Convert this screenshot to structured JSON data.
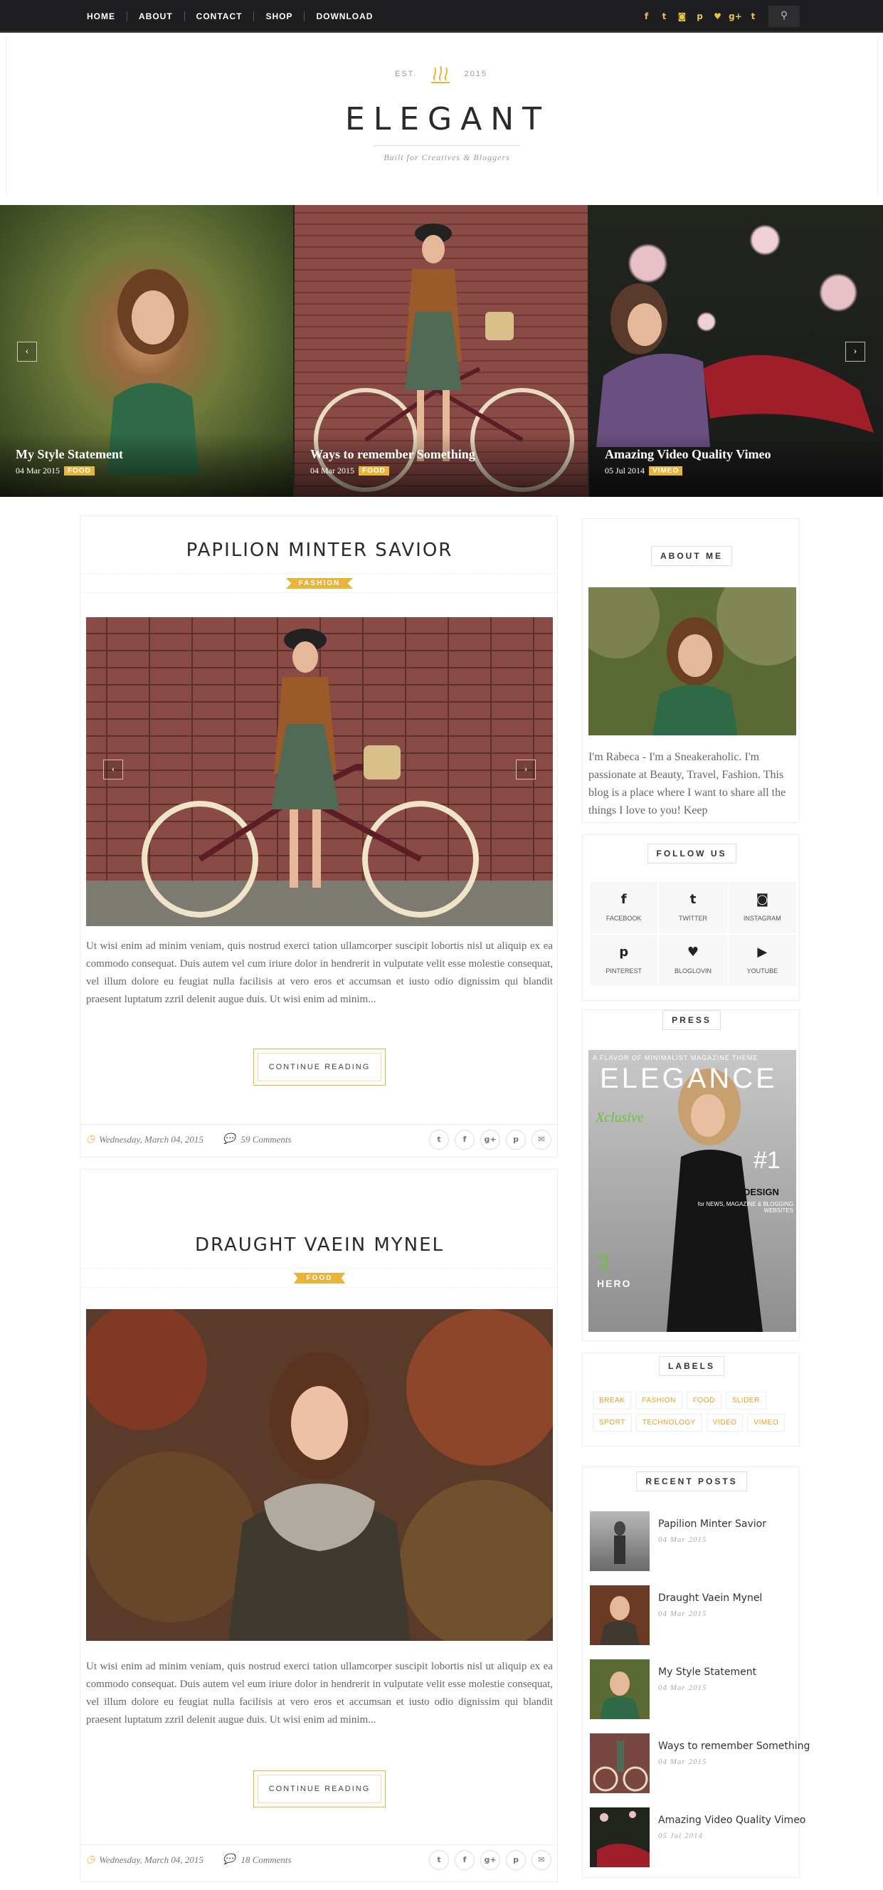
{
  "topbar": {
    "nav": [
      "HOME",
      "ABOUT",
      "CONTACT",
      "SHOP",
      "DOWNLOAD"
    ],
    "social_icons": [
      "facebook-icon",
      "twitter-icon",
      "instagram-icon",
      "pinterest-icon",
      "heart-icon",
      "google-plus-icon",
      "tumblr-icon"
    ],
    "social_glyphs": [
      "f",
      "t",
      "◙",
      "p",
      "♥",
      "g+",
      "t"
    ],
    "search_glyph": "⚲"
  },
  "header": {
    "est": "EST.",
    "year": "2015",
    "logo": "ELEGANT",
    "tagline": "Built for Creatives & Bloggers"
  },
  "slider": {
    "slides": [
      {
        "title": "My Style Statement",
        "date": "04 Mar 2015",
        "tag": "FOOD"
      },
      {
        "title": "Ways to remember Something",
        "date": "04 Mar 2015",
        "tag": "FOOD"
      },
      {
        "title": "Amazing Video Quality Vimeo",
        "date": "05 Jul 2014",
        "tag": "VIMEO"
      }
    ],
    "prev": "‹",
    "next": "›"
  },
  "posts": [
    {
      "title": "PAPILION MINTER SAVIOR",
      "category": "FASHION",
      "excerpt": "Ut wisi enim ad minim veniam, quis nostrud exerci tation ullamcorper suscipit lobortis nisl ut aliquip ex ea commodo consequat. Duis autem vel cum iriure dolor in hendrerit in vulputate velit esse molestie consequat, vel illum dolore eu feugiat nulla facilisis at vero eros et accumsan et iusto odio dignissim qui blandit praesent luptatum zzril delenit augue duis. Ut wisi enim ad minim...",
      "button": "CONTINUE READING",
      "date": "Wednesday, March 04, 2015",
      "comments": "59 Comments"
    },
    {
      "title": "DRAUGHT VAEIN MYNEL",
      "category": "FOOD",
      "excerpt": "Ut wisi enim ad minim veniam, quis nostrud exerci tation ullamcorper suscipit lobortis nisl ut aliquip ex ea commodo consequat. Duis autem vel eum iriure dolor in hendrerit in vulputate velit esse molestie consequat, vel illum dolore eu feugiat nulla facilisis at vero eros et accumsan et iusto odio dignissim qui blandit praesent luptatum zzril delenit augue duis. Ut wisi enim ad minim...",
      "button": "CONTINUE READING",
      "date": "Wednesday, March 04, 2015",
      "comments": "18 Comments"
    }
  ],
  "share_glyphs": [
    "t",
    "f",
    "g+",
    "p",
    "✉"
  ],
  "sidebar": {
    "about": {
      "title": "ABOUT ME",
      "text": "I'm Rabeca - I'm a Sneakeraholic. I'm passionate at Beauty, Travel, Fashion. This blog is a place where I want to share all the things I love to you! Keep"
    },
    "follow": {
      "title": "FOLLOW US",
      "items": [
        {
          "glyph": "f",
          "label": "FACEBOOK"
        },
        {
          "glyph": "t",
          "label": "TWITTER"
        },
        {
          "glyph": "◙",
          "label": "INSTAGRAM"
        },
        {
          "glyph": "p",
          "label": "PINTEREST"
        },
        {
          "glyph": "♥",
          "label": "BLOGLOVIN"
        },
        {
          "glyph": "▶",
          "label": "YOUTUBE"
        }
      ]
    },
    "press": {
      "title": "PRESS",
      "cover_top": "A FLAVOR OF MINIMALIST MAGAZINE THEME",
      "cover_title": "ELEGANCE",
      "cover_exclusive": "Xclusive",
      "cover_number": "#1",
      "cover_design": "DESIGN",
      "cover_for": "for NEWS, MAGAZINE & BLOGGING WEBSITES",
      "cover_hero_num": "3",
      "cover_hero": "HERO"
    },
    "labels": {
      "title": "LABELS",
      "items": [
        "BREAK",
        "FASHION",
        "FOOD",
        "SLIDER",
        "SPORT",
        "TECHNOLOGY",
        "VIDEO",
        "VIMEO"
      ]
    },
    "recent": {
      "title": "RECENT POSTS",
      "items": [
        {
          "title": "Papilion Minter Savior",
          "date": "04 Mar 2015"
        },
        {
          "title": "Draught Vaein Mynel",
          "date": "04 Mar 2015"
        },
        {
          "title": "My Style Statement",
          "date": "04 Mar 2015"
        },
        {
          "title": "Ways to remember Something",
          "date": "04 Mar 2015"
        },
        {
          "title": "Amazing Video Quality Vimeo",
          "date": "05 Jul 2014"
        }
      ]
    }
  },
  "colors": {
    "accent": "#e7b53c",
    "topbar": "#1e1e20"
  }
}
